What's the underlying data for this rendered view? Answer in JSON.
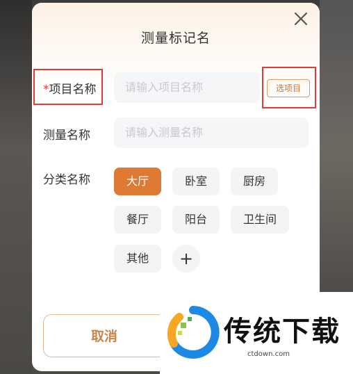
{
  "dialog": {
    "title": "测量标记名",
    "close_icon": "close-icon"
  },
  "form": {
    "project": {
      "required_mark": "*",
      "label": "项目名称",
      "placeholder": "请输入项目名称",
      "pick_button": "选项目"
    },
    "measure": {
      "label": "测量名称",
      "placeholder": "请输入测量名称"
    },
    "category": {
      "label": "分类名称",
      "options": [
        "大厅",
        "卧室",
        "厨房",
        "餐厅",
        "阳台",
        "卫生间",
        "其他"
      ],
      "selected": "大厅",
      "add_icon": "plus-icon"
    }
  },
  "actions": {
    "cancel": "取消"
  },
  "watermark": {
    "title": "传统下载",
    "url": "ctdown.com"
  },
  "colors": {
    "accent": "#de7a33",
    "highlight_box": "#e53935"
  }
}
